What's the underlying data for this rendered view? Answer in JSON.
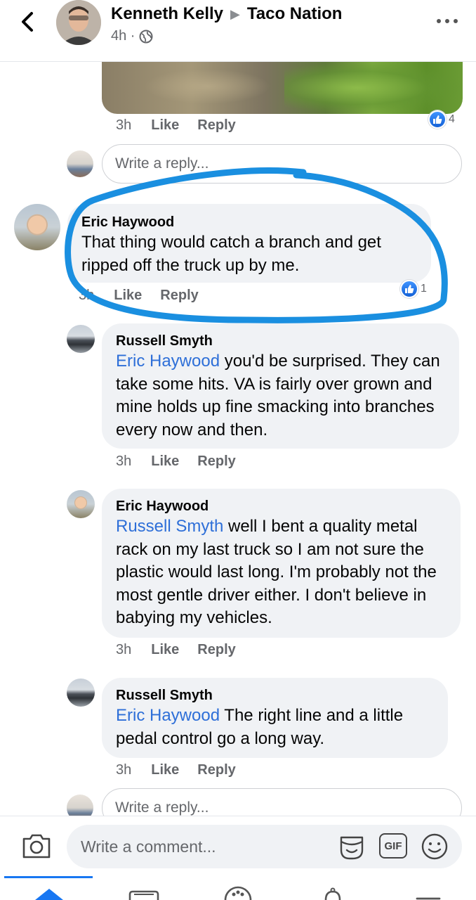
{
  "header": {
    "author": "Kenneth Kelly",
    "group": "Taco Nation",
    "time": "4h ·"
  },
  "thread": {
    "top_comment": {
      "time": "3h",
      "like_label": "Like",
      "reply_label": "Reply",
      "reactions": "4"
    },
    "reply_placeholder_1": "Write a reply...",
    "comments": [
      {
        "author": "Eric Haywood",
        "mention": "",
        "text": "That thing would catch a branch and get ripped off the truck up by me.",
        "time": "3h",
        "like_label": "Like",
        "reply_label": "Reply",
        "reactions": "1"
      },
      {
        "author": "Russell Smyth",
        "mention": "Eric Haywood",
        "text": " you'd be surprised. They can take some hits. VA is fairly over grown and mine holds up fine smacking into branches every now and then.",
        "time": "3h",
        "like_label": "Like",
        "reply_label": "Reply"
      },
      {
        "author": "Eric Haywood",
        "mention": "Russell Smyth",
        "text": " well I bent a quality metal rack on my last truck so I am not sure the plastic would last long. I'm probably not the most gentle driver either. I don't believe in babying my vehicles.",
        "time": "3h",
        "like_label": "Like",
        "reply_label": "Reply"
      },
      {
        "author": "Russell Smyth",
        "mention": "Eric Haywood",
        "text": " The right line and a little pedal control go a long way.",
        "time": "3h",
        "like_label": "Like",
        "reply_label": "Reply"
      }
    ],
    "reply_placeholder_2": "Write a reply..."
  },
  "composer": {
    "placeholder": "Write a comment...",
    "gif_label": "GIF"
  },
  "colors": {
    "accent": "#1877f2",
    "mention": "#2e6fd8",
    "highlight_stroke": "#1a8fe0",
    "bubble": "#f0f2f5"
  },
  "icons": [
    "back-arrow-icon",
    "globe-icon",
    "more-icon",
    "like-icon",
    "camera-icon",
    "sticker-icon",
    "gif-icon",
    "emoji-icon",
    "home-icon",
    "marketplace-icon",
    "groups-icon",
    "notifications-icon",
    "menu-icon"
  ]
}
